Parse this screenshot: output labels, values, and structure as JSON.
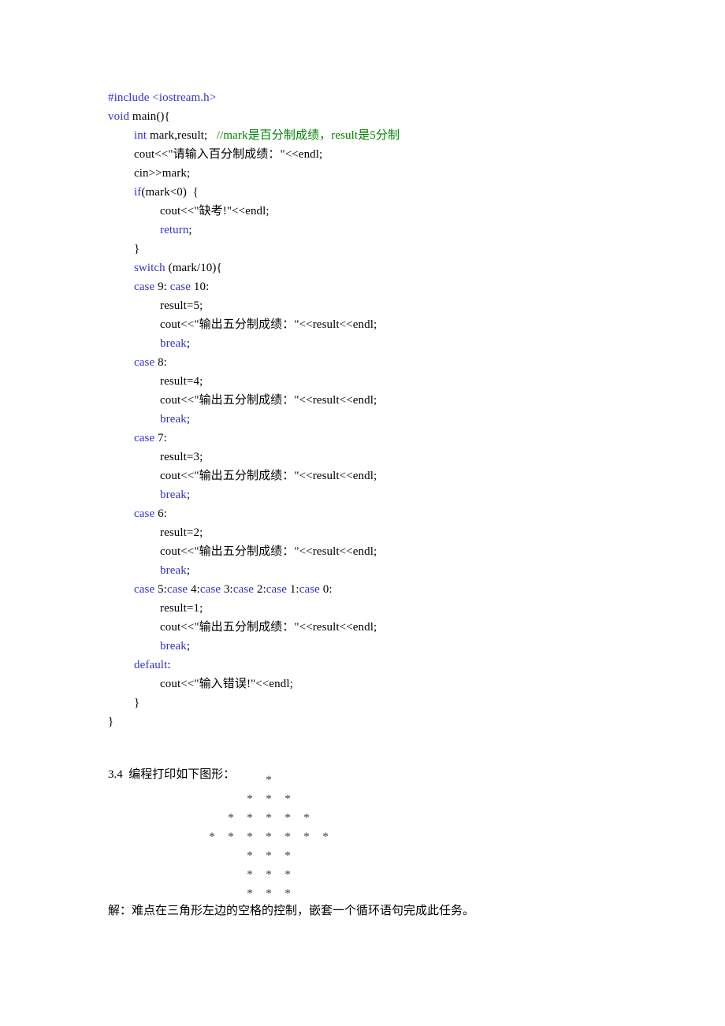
{
  "page": {
    "background_color": "#ffffff",
    "text_color": "#000000",
    "keyword_color": "#3333cc",
    "comment_color": "#008000",
    "star_color": "#3a3a3a"
  },
  "code_listing": {
    "language": "cpp",
    "lines": [
      {
        "indent": 0,
        "spans": [
          {
            "t": "#include ",
            "c": "kw"
          },
          {
            "t": "<iostream.h>",
            "c": "kw"
          }
        ]
      },
      {
        "indent": 0,
        "spans": [
          {
            "t": "void",
            "c": "kw"
          },
          {
            "t": " main(){",
            "c": "plain"
          }
        ]
      },
      {
        "indent": 1,
        "spans": [
          {
            "t": "int",
            "c": "kw"
          },
          {
            "t": " mark,result;   ",
            "c": "plain"
          },
          {
            "t": "//mark是百分制成绩，result是5分制",
            "c": "cmt"
          }
        ]
      },
      {
        "indent": 1,
        "spans": [
          {
            "t": "cout<<\"请输入百分制成绩：\"<<endl;",
            "c": "plain"
          }
        ]
      },
      {
        "indent": 1,
        "spans": [
          {
            "t": "cin>>mark;",
            "c": "plain"
          }
        ]
      },
      {
        "indent": 1,
        "spans": [
          {
            "t": "if",
            "c": "kw"
          },
          {
            "t": "(mark<0)  {",
            "c": "plain"
          }
        ]
      },
      {
        "indent": 2,
        "spans": [
          {
            "t": "cout<<\"缺考!\"<<endl;",
            "c": "plain"
          }
        ]
      },
      {
        "indent": 2,
        "spans": [
          {
            "t": "return",
            "c": "kw"
          },
          {
            "t": ";",
            "c": "plain"
          }
        ]
      },
      {
        "indent": 1,
        "spans": [
          {
            "t": "}",
            "c": "plain"
          }
        ]
      },
      {
        "indent": 1,
        "spans": [
          {
            "t": "switch",
            "c": "kw"
          },
          {
            "t": " (mark/10){",
            "c": "plain"
          }
        ]
      },
      {
        "indent": 1,
        "spans": [
          {
            "t": "case",
            "c": "kw"
          },
          {
            "t": " 9: ",
            "c": "plain"
          },
          {
            "t": "case",
            "c": "kw"
          },
          {
            "t": " 10:",
            "c": "plain"
          }
        ]
      },
      {
        "indent": 2,
        "spans": [
          {
            "t": "result=5;",
            "c": "plain"
          }
        ]
      },
      {
        "indent": 2,
        "spans": [
          {
            "t": "cout<<\"输出五分制成绩：\"<<result<<endl;",
            "c": "plain"
          }
        ]
      },
      {
        "indent": 2,
        "spans": [
          {
            "t": "break",
            "c": "kw"
          },
          {
            "t": ";",
            "c": "plain"
          }
        ]
      },
      {
        "indent": 1,
        "spans": [
          {
            "t": "case",
            "c": "kw"
          },
          {
            "t": " 8:",
            "c": "plain"
          }
        ]
      },
      {
        "indent": 2,
        "spans": [
          {
            "t": "result=4;",
            "c": "plain"
          }
        ]
      },
      {
        "indent": 2,
        "spans": [
          {
            "t": "cout<<\"输出五分制成绩：\"<<result<<endl;",
            "c": "plain"
          }
        ]
      },
      {
        "indent": 2,
        "spans": [
          {
            "t": "break",
            "c": "kw"
          },
          {
            "t": ";",
            "c": "plain"
          }
        ]
      },
      {
        "indent": 1,
        "spans": [
          {
            "t": "case",
            "c": "kw"
          },
          {
            "t": " 7:",
            "c": "plain"
          }
        ]
      },
      {
        "indent": 2,
        "spans": [
          {
            "t": "result=3;",
            "c": "plain"
          }
        ]
      },
      {
        "indent": 2,
        "spans": [
          {
            "t": "cout<<\"输出五分制成绩：\"<<result<<endl;",
            "c": "plain"
          }
        ]
      },
      {
        "indent": 2,
        "spans": [
          {
            "t": "break",
            "c": "kw"
          },
          {
            "t": ";",
            "c": "plain"
          }
        ]
      },
      {
        "indent": 1,
        "spans": [
          {
            "t": "case",
            "c": "kw"
          },
          {
            "t": " 6:",
            "c": "plain"
          }
        ]
      },
      {
        "indent": 2,
        "spans": [
          {
            "t": "result=2;",
            "c": "plain"
          }
        ]
      },
      {
        "indent": 2,
        "spans": [
          {
            "t": "cout<<\"输出五分制成绩：\"<<result<<endl;",
            "c": "plain"
          }
        ]
      },
      {
        "indent": 2,
        "spans": [
          {
            "t": "break",
            "c": "kw"
          },
          {
            "t": ";",
            "c": "plain"
          }
        ]
      },
      {
        "indent": 1,
        "spans": [
          {
            "t": "case",
            "c": "kw"
          },
          {
            "t": " 5:",
            "c": "plain"
          },
          {
            "t": "case",
            "c": "kw"
          },
          {
            "t": " 4:",
            "c": "plain"
          },
          {
            "t": "case",
            "c": "kw"
          },
          {
            "t": " 3:",
            "c": "plain"
          },
          {
            "t": "case",
            "c": "kw"
          },
          {
            "t": " 2:",
            "c": "plain"
          },
          {
            "t": "case",
            "c": "kw"
          },
          {
            "t": " 1:",
            "c": "plain"
          },
          {
            "t": "case",
            "c": "kw"
          },
          {
            "t": " 0:",
            "c": "plain"
          }
        ]
      },
      {
        "indent": 2,
        "spans": [
          {
            "t": "result=1;",
            "c": "plain"
          }
        ]
      },
      {
        "indent": 2,
        "spans": [
          {
            "t": "cout<<\"输出五分制成绩：\"<<result<<endl;",
            "c": "plain"
          }
        ]
      },
      {
        "indent": 2,
        "spans": [
          {
            "t": "break",
            "c": "kw"
          },
          {
            "t": ";",
            "c": "plain"
          }
        ]
      },
      {
        "indent": 1,
        "spans": [
          {
            "t": "default",
            "c": "kw"
          },
          {
            "t": ":",
            "c": "plain"
          }
        ]
      },
      {
        "indent": 2,
        "spans": [
          {
            "t": "cout<<\"输入错误!\"<<endl;",
            "c": "plain"
          }
        ]
      },
      {
        "indent": 1,
        "spans": [
          {
            "t": "}",
            "c": "plain"
          }
        ]
      },
      {
        "indent": 0,
        "spans": [
          {
            "t": "}",
            "c": "plain"
          }
        ]
      }
    ]
  },
  "exercise": {
    "number": "3.4",
    "heading": "3.4  编程打印如下图形：",
    "star_glyph": "*",
    "figure_rows": [
      {
        "offset": 3,
        "count": 1
      },
      {
        "offset": 2,
        "count": 3
      },
      {
        "offset": 1,
        "count": 5
      },
      {
        "offset": 0,
        "count": 7
      },
      {
        "offset": 2,
        "count": 3
      },
      {
        "offset": 2,
        "count": 3
      },
      {
        "offset": 2,
        "count": 3
      }
    ],
    "figure_indent_cells": 5
  },
  "solution": {
    "text": "解：难点在三角形左边的空格的控制，嵌套一个循环语句完成此任务。"
  }
}
